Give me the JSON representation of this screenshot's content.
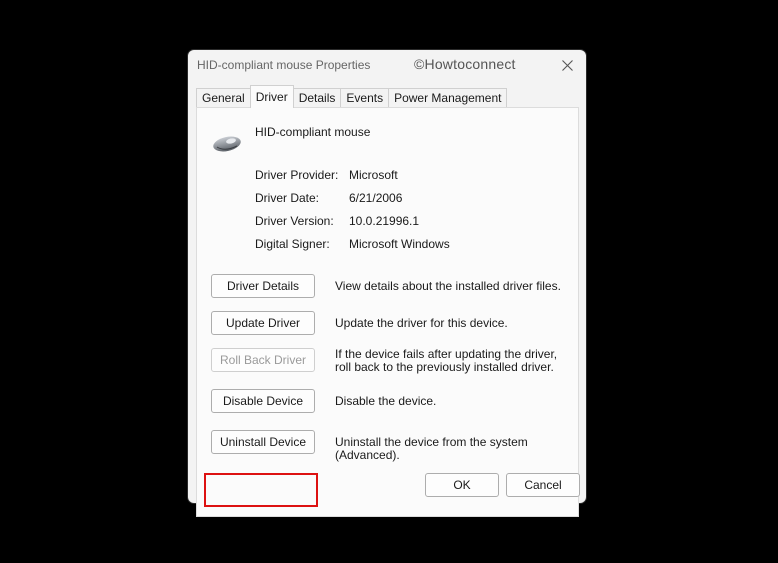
{
  "window": {
    "title": "HID-compliant mouse Properties",
    "watermark": "©Howtoconnect",
    "close_icon": "close-icon"
  },
  "tabs": [
    {
      "label": "General",
      "active": false
    },
    {
      "label": "Driver",
      "active": true
    },
    {
      "label": "Details",
      "active": false
    },
    {
      "label": "Events",
      "active": false
    },
    {
      "label": "Power Management",
      "active": false
    }
  ],
  "device": {
    "name": "HID-compliant mouse",
    "icon": "mouse-icon"
  },
  "info": [
    {
      "label": "Driver Provider:",
      "value": "Microsoft"
    },
    {
      "label": "Driver Date:",
      "value": "6/21/2006"
    },
    {
      "label": "Driver Version:",
      "value": "10.0.21996.1"
    },
    {
      "label": "Digital Signer:",
      "value": "Microsoft Windows"
    }
  ],
  "actions": [
    {
      "label": "Driver Details",
      "desc": "View details about the installed driver files.",
      "enabled": true
    },
    {
      "label": "Update Driver",
      "desc": "Update the driver for this device.",
      "enabled": true
    },
    {
      "label": "Roll Back Driver",
      "desc": "If the device fails after updating the driver, roll back to the previously installed driver.",
      "enabled": false
    },
    {
      "label": "Disable Device",
      "desc": "Disable the device.",
      "enabled": true
    },
    {
      "label": "Uninstall Device",
      "desc": "Uninstall the device from the system (Advanced).",
      "enabled": true,
      "highlighted": true
    }
  ],
  "footer": {
    "ok_label": "OK",
    "cancel_label": "Cancel"
  },
  "colors": {
    "highlight": "#dd1111",
    "background": "#000000",
    "dialog": "#f3f3f3"
  }
}
